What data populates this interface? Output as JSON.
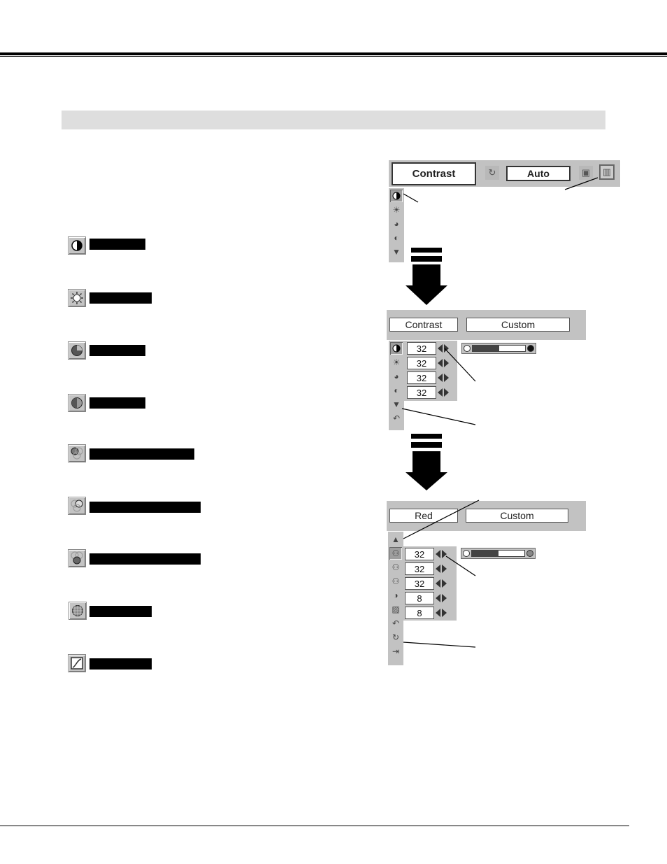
{
  "page": {
    "section_header": "",
    "feature_list": [
      {
        "icon": "contrast-icon",
        "label": ""
      },
      {
        "icon": "brightness-icon",
        "label": ""
      },
      {
        "icon": "color-icon",
        "label": ""
      },
      {
        "icon": "tint-icon",
        "label": ""
      },
      {
        "icon": "white-balance-red-icon",
        "label": ""
      },
      {
        "icon": "white-balance-green-icon",
        "label": ""
      },
      {
        "icon": "white-balance-blue-icon",
        "label": ""
      },
      {
        "icon": "sharpness-icon",
        "label": ""
      },
      {
        "icon": "gamma-icon",
        "label": ""
      }
    ]
  },
  "menu1": {
    "item_label": "Contrast",
    "mode_value": "Auto",
    "side_icons": [
      "contrast-icon",
      "brightness-icon",
      "color-icon",
      "tint-icon",
      "more-down-icon"
    ],
    "toolbar_icons": [
      "image-mode-icon",
      "store-icon",
      "image-adjust-icon"
    ]
  },
  "menu2": {
    "item_label": "Contrast",
    "mode_value": "Custom",
    "rows": [
      {
        "icon": "contrast-icon",
        "value": "32"
      },
      {
        "icon": "brightness-icon",
        "value": "32"
      },
      {
        "icon": "color-icon",
        "value": "32"
      },
      {
        "icon": "tint-icon",
        "value": "32"
      }
    ],
    "extra_icons": [
      "more-down-icon",
      "reset-icon"
    ],
    "slider_fraction": 0.5
  },
  "menu3": {
    "item_label": "Red",
    "mode_value": "Custom",
    "top_icon": "more-up-icon",
    "rows": [
      {
        "icon": "white-balance-red-icon",
        "value": "32"
      },
      {
        "icon": "white-balance-green-icon",
        "value": "32"
      },
      {
        "icon": "white-balance-blue-icon",
        "value": "32"
      },
      {
        "icon": "sharpness-icon",
        "value": "8"
      },
      {
        "icon": "gamma-icon",
        "value": "8"
      }
    ],
    "extra_icons": [
      "reset-icon",
      "store-icon",
      "quit-icon"
    ],
    "slider_fraction": 0.5
  }
}
